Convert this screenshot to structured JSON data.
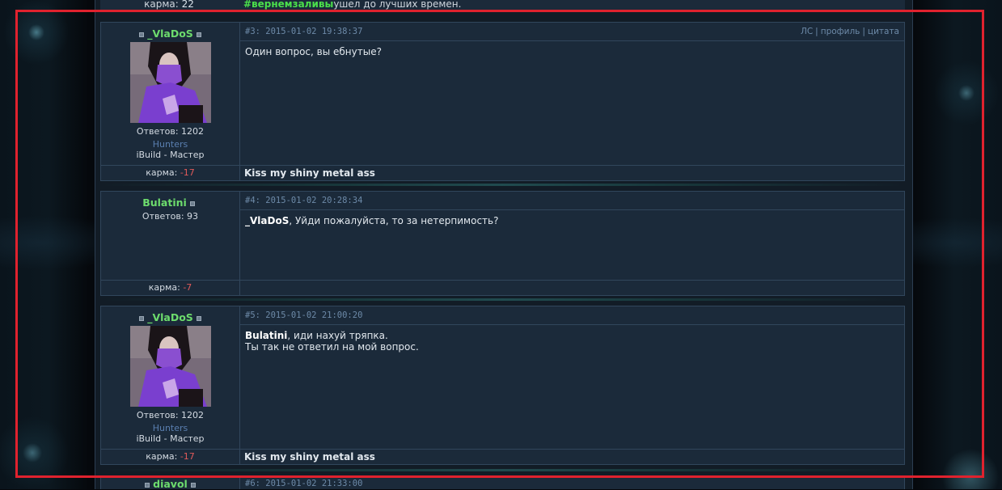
{
  "top": {
    "karma_label": "карма: ",
    "karma_value": "22",
    "sig_tag": "#вернемзаливы",
    "sig_text": "ушел до лучших времен."
  },
  "posts": [
    {
      "username": "_VlaDoS",
      "replies": "Ответов: 1202",
      "team": "Hunters",
      "rank": "iBuild - Мастер",
      "karma_label": "карма: ",
      "karma_value": "-17",
      "header": "#3: 2015-01-02 19:38:37",
      "actions": {
        "pm": "ЛС",
        "profile": "профиль",
        "quote": "цитата"
      },
      "body_line1": "Один вопрос, вы ебнутые?",
      "signature": "Kiss my shiny metal ass"
    },
    {
      "username": "Bulatini",
      "replies": "Ответов: 93",
      "karma_label": "карма: ",
      "karma_value": "-7",
      "header": "#4: 2015-01-02 20:28:34",
      "body_mention": "_VlaDoS",
      "body_text": ", Уйди пожалуйста, то за нетерпимость?"
    },
    {
      "username": "_VlaDoS",
      "replies": "Ответов: 1202",
      "team": "Hunters",
      "rank": "iBuild - Мастер",
      "karma_label": "карма: ",
      "karma_value": "-17",
      "header": "#5: 2015-01-02 21:00:20",
      "body_mention": "Bulatini",
      "body_text": ", иди нахуй тряпка.",
      "body_line2": "Ты так не ответил на мой вопрос.",
      "signature": "Kiss my shiny metal ass"
    },
    {
      "username": "diavol",
      "header": "#6: 2015-01-02 21:33:00"
    }
  ]
}
